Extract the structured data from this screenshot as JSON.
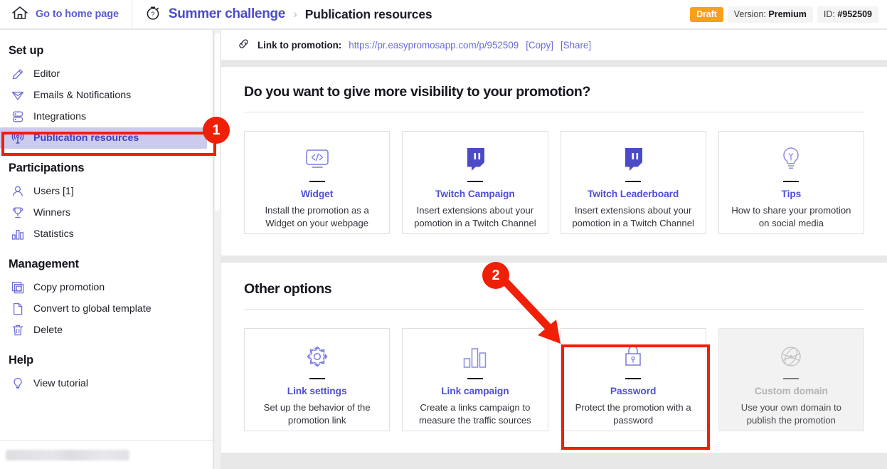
{
  "topbar": {
    "home_label": "Go to home page",
    "home_icon": "home-icon",
    "project_icon": "stopwatch-question-icon",
    "project_name": "Summer challenge",
    "separator": "›",
    "current_page": "Publication resources",
    "status_badge": "Draft",
    "version_prefix": "Version: ",
    "version_value": "Premium",
    "id_prefix": "ID: ",
    "id_value": "#952509"
  },
  "sidebar": {
    "sections": [
      {
        "title": "Set up",
        "items": [
          {
            "label": "Editor",
            "icon": "pencil-icon",
            "active": false
          },
          {
            "label": "Emails & Notifications",
            "icon": "paper-plane-icon",
            "active": false
          },
          {
            "label": "Integrations",
            "icon": "server-icon",
            "active": false
          },
          {
            "label": "Publication resources",
            "icon": "broadcast-antenna-icon",
            "active": true
          }
        ]
      },
      {
        "title": "Participations",
        "items": [
          {
            "label": "Users [1]",
            "icon": "user-icon",
            "active": false
          },
          {
            "label": "Winners",
            "icon": "trophy-icon",
            "active": false
          },
          {
            "label": "Statistics",
            "icon": "bar-chart-icon",
            "active": false
          }
        ]
      },
      {
        "title": "Management",
        "items": [
          {
            "label": "Copy promotion",
            "icon": "copy-icon",
            "active": false
          },
          {
            "label": "Convert to global template",
            "icon": "document-icon",
            "active": false
          },
          {
            "label": "Delete",
            "icon": "trash-icon",
            "active": false
          }
        ]
      },
      {
        "title": "Help",
        "items": [
          {
            "label": "View tutorial",
            "icon": "lightbulb-icon",
            "active": false
          }
        ]
      }
    ]
  },
  "link_bar": {
    "icon": "chain-link-icon",
    "label": "Link to promotion:",
    "url": "https://pr.easypromosapp.com/p/952509",
    "copy_action": "[Copy]",
    "share_action": "[Share]"
  },
  "visibility_section": {
    "title": "Do you want to give more visibility to your promotion?",
    "tiles": [
      {
        "icon": "code-window-icon",
        "title": "Widget",
        "desc": "Install the promotion as a Widget on your webpage",
        "disabled": false
      },
      {
        "icon": "twitch-icon",
        "title": "Twitch Campaign",
        "desc": "Insert extensions about your pomotion in a Twitch Channel",
        "disabled": false
      },
      {
        "icon": "twitch-icon",
        "title": "Twitch Leaderboard",
        "desc": "Insert extensions about your pomotion in a Twitch Channel",
        "disabled": false
      },
      {
        "icon": "lightbulb-icon",
        "title": "Tips",
        "desc": "How to share your promotion on social media",
        "disabled": false
      }
    ]
  },
  "other_section": {
    "title": "Other options",
    "tiles": [
      {
        "icon": "gear-icon",
        "title": "Link settings",
        "desc": "Set up the behavior of the promotion link",
        "disabled": false
      },
      {
        "icon": "bar-chart-icon",
        "title": "Link campaign",
        "desc": "Create a links campaign to measure the traffic sources",
        "disabled": false
      },
      {
        "icon": "lock-icon",
        "title": "Password",
        "desc": "Protect the promotion with a password",
        "disabled": false
      },
      {
        "icon": "globe-icon",
        "title": "Custom domain",
        "desc": "Use your own domain to publish the promotion",
        "disabled": true
      }
    ]
  },
  "annotations": {
    "marker_one": "1",
    "marker_two": "2",
    "highlight_color": "#f01f08"
  }
}
